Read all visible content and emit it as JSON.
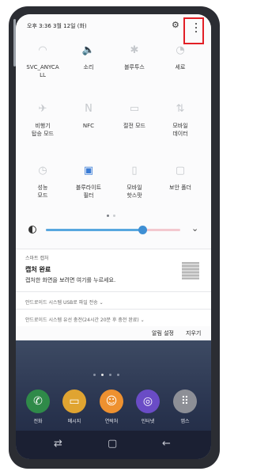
{
  "status_bar": {
    "time_date": "오후 3:36   3월 12일 (화)",
    "settings_icon": "gear-icon",
    "more_icon": "more-vert-icon"
  },
  "quick_tiles": [
    {
      "label": "SVC_ANYCA\nLL",
      "icon": "wifi-icon",
      "glyph": "◠",
      "active": false
    },
    {
      "label": "소리",
      "icon": "sound-icon",
      "glyph": "🔈",
      "active": true
    },
    {
      "label": "블루투스",
      "icon": "bluetooth-icon",
      "glyph": "✱",
      "active": false
    },
    {
      "label": "세로",
      "icon": "rotation-lock-icon",
      "glyph": "◔",
      "active": false
    },
    {
      "label": "비행기\n탑승 모드",
      "icon": "airplane-icon",
      "glyph": "✈",
      "active": false
    },
    {
      "label": "NFC",
      "icon": "nfc-icon",
      "glyph": "N",
      "active": false
    },
    {
      "label": "절전 모드",
      "icon": "power-saving-icon",
      "glyph": "▭",
      "active": false
    },
    {
      "label": "모바일\n데이터",
      "icon": "mobile-data-icon",
      "glyph": "⇅",
      "active": false
    },
    {
      "label": "성능\n모드",
      "icon": "performance-icon",
      "glyph": "◷",
      "active": false
    },
    {
      "label": "블루라이트\n필터",
      "icon": "blue-light-filter-icon",
      "glyph": "▣",
      "active": true
    },
    {
      "label": "모바일\n핫스팟",
      "icon": "hotspot-icon",
      "glyph": "▯",
      "active": false
    },
    {
      "label": "보안 폴더",
      "icon": "secure-folder-icon",
      "glyph": "▢",
      "active": false
    }
  ],
  "brightness": {
    "level": 0.72,
    "expand_icon": "chevron-down-icon",
    "glyph": "⌄"
  },
  "notifications": [
    {
      "app": "스마트 캡처",
      "title": "캡처 완료",
      "body": "캡처한 화면을 보려면 여기를 누르세요."
    },
    {
      "app": "안드로이드 시스템  USB로 파일 전송 ⌄"
    },
    {
      "app": "안드로이드 시스템  유선 충전(24시간 20분 후 충전 완료) ⌄"
    }
  ],
  "actions": {
    "notification_settings": "알림 설정",
    "clear": "지우기"
  },
  "dock_apps": [
    {
      "name": "전화",
      "icon": "phone-icon",
      "color": "#2f8a49",
      "glyph": "✆"
    },
    {
      "name": "메시지",
      "icon": "message-icon",
      "color": "#e0a431",
      "glyph": "▭"
    },
    {
      "name": "연락처",
      "icon": "contacts-icon",
      "color": "#ee9130",
      "glyph": "☺"
    },
    {
      "name": "인터넷",
      "icon": "internet-icon",
      "color": "#6a4cc6",
      "glyph": "◎"
    },
    {
      "name": "앱스",
      "icon": "apps-icon",
      "color": "#8d8f96",
      "glyph": "⠿"
    }
  ],
  "nav_bar": {
    "recent": "⇄",
    "home": "▢",
    "back": "←"
  }
}
